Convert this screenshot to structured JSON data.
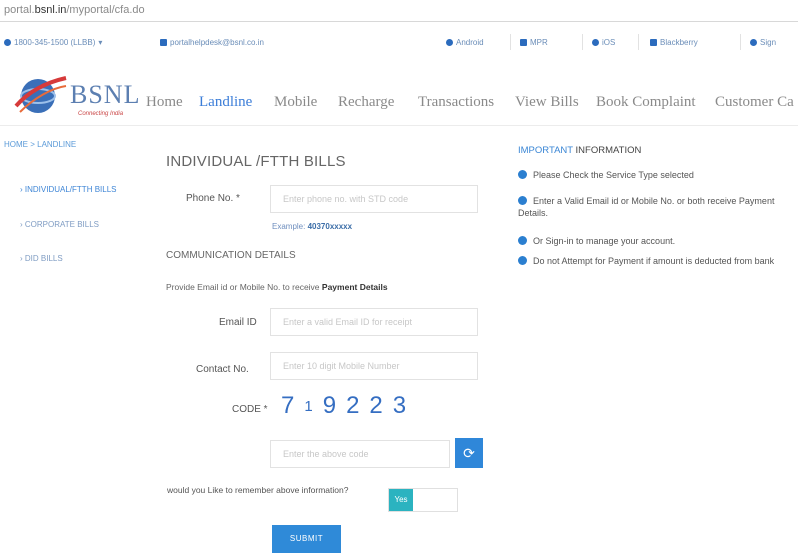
{
  "browser": {
    "url_prefix": "portal.",
    "url_domain": "bsnl.in",
    "url_path": "/myportal/cfa.do"
  },
  "topstrip": {
    "phone": "1800-345-1500 (LLBB)",
    "email": "portalhelpdesk@bsnl.co.in",
    "links": [
      "Android",
      "MPR",
      "iOS",
      "Blackberry",
      "Sign"
    ]
  },
  "nav": {
    "brand": "BSNL",
    "tagline": "Connecting India",
    "items": [
      "Home",
      "Landline",
      "Mobile",
      "Recharge",
      "Transactions",
      "View Bills",
      "Book Complaint",
      "Customer Ca"
    ],
    "active": "Landline"
  },
  "sidebar": {
    "breadcrumb": "HOME > LANDLINE",
    "items": [
      "INDIVIDUAL/FTTH BILLS",
      "CORPORATE BILLS",
      "DID BILLS"
    ]
  },
  "form": {
    "title": "INDIVIDUAL /FTTH BILLS",
    "phone_label": "Phone No. *",
    "phone_placeholder": "Enter phone no. with STD code",
    "example_prefix": "Example: ",
    "example_value": "40370xxxxx",
    "section_heading": "COMMUNICATION DETAILS",
    "provide_text": "Provide Email id or Mobile No. to receive ",
    "provide_bold": "Payment Details",
    "email_label": "Email ID",
    "email_placeholder": "Enter a valid Email ID for receipt",
    "contact_label": "Contact No.",
    "contact_placeholder": "Enter 10 digit Mobile Number",
    "code_label": "CODE *",
    "captcha": [
      "7",
      "1",
      "9",
      "2",
      "2",
      "3"
    ],
    "captcha_placeholder": "Enter the above code",
    "remember_text": "would you Like to remember above information?",
    "toggle_label": "Yes",
    "submit_label": "SUBMIT"
  },
  "info": {
    "title_accent": "IMPORTANT",
    "title_rest": " INFORMATION",
    "items": [
      "Please Check the Service Type selected",
      "Enter a Valid Email id or Mobile No. or both receive Payment Details.",
      "Or Sign-in to manage your account.",
      "Do not Attempt for Payment if amount is deducted from bank"
    ]
  }
}
